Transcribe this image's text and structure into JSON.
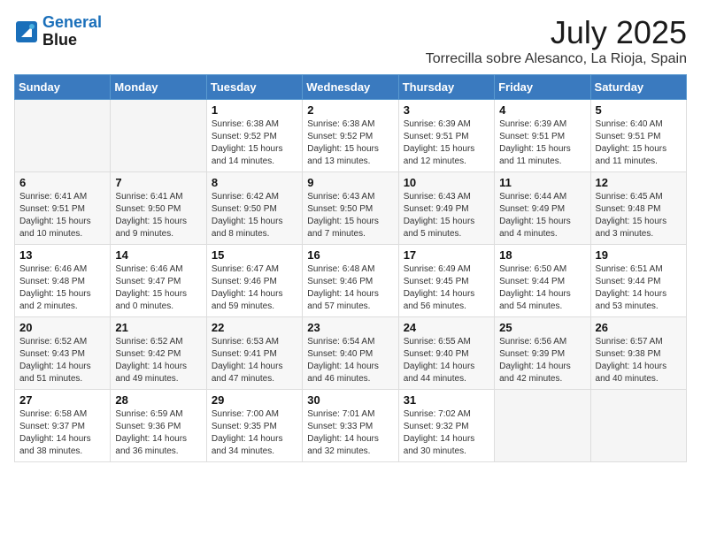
{
  "logo": {
    "line1": "General",
    "line2": "Blue"
  },
  "title": "July 2025",
  "location": "Torrecilla sobre Alesanco, La Rioja, Spain",
  "days_of_week": [
    "Sunday",
    "Monday",
    "Tuesday",
    "Wednesday",
    "Thursday",
    "Friday",
    "Saturday"
  ],
  "weeks": [
    [
      {
        "day": "",
        "info": ""
      },
      {
        "day": "",
        "info": ""
      },
      {
        "day": "1",
        "info": "Sunrise: 6:38 AM\nSunset: 9:52 PM\nDaylight: 15 hours and 14 minutes."
      },
      {
        "day": "2",
        "info": "Sunrise: 6:38 AM\nSunset: 9:52 PM\nDaylight: 15 hours and 13 minutes."
      },
      {
        "day": "3",
        "info": "Sunrise: 6:39 AM\nSunset: 9:51 PM\nDaylight: 15 hours and 12 minutes."
      },
      {
        "day": "4",
        "info": "Sunrise: 6:39 AM\nSunset: 9:51 PM\nDaylight: 15 hours and 11 minutes."
      },
      {
        "day": "5",
        "info": "Sunrise: 6:40 AM\nSunset: 9:51 PM\nDaylight: 15 hours and 11 minutes."
      }
    ],
    [
      {
        "day": "6",
        "info": "Sunrise: 6:41 AM\nSunset: 9:51 PM\nDaylight: 15 hours and 10 minutes."
      },
      {
        "day": "7",
        "info": "Sunrise: 6:41 AM\nSunset: 9:50 PM\nDaylight: 15 hours and 9 minutes."
      },
      {
        "day": "8",
        "info": "Sunrise: 6:42 AM\nSunset: 9:50 PM\nDaylight: 15 hours and 8 minutes."
      },
      {
        "day": "9",
        "info": "Sunrise: 6:43 AM\nSunset: 9:50 PM\nDaylight: 15 hours and 7 minutes."
      },
      {
        "day": "10",
        "info": "Sunrise: 6:43 AM\nSunset: 9:49 PM\nDaylight: 15 hours and 5 minutes."
      },
      {
        "day": "11",
        "info": "Sunrise: 6:44 AM\nSunset: 9:49 PM\nDaylight: 15 hours and 4 minutes."
      },
      {
        "day": "12",
        "info": "Sunrise: 6:45 AM\nSunset: 9:48 PM\nDaylight: 15 hours and 3 minutes."
      }
    ],
    [
      {
        "day": "13",
        "info": "Sunrise: 6:46 AM\nSunset: 9:48 PM\nDaylight: 15 hours and 2 minutes."
      },
      {
        "day": "14",
        "info": "Sunrise: 6:46 AM\nSunset: 9:47 PM\nDaylight: 15 hours and 0 minutes."
      },
      {
        "day": "15",
        "info": "Sunrise: 6:47 AM\nSunset: 9:46 PM\nDaylight: 14 hours and 59 minutes."
      },
      {
        "day": "16",
        "info": "Sunrise: 6:48 AM\nSunset: 9:46 PM\nDaylight: 14 hours and 57 minutes."
      },
      {
        "day": "17",
        "info": "Sunrise: 6:49 AM\nSunset: 9:45 PM\nDaylight: 14 hours and 56 minutes."
      },
      {
        "day": "18",
        "info": "Sunrise: 6:50 AM\nSunset: 9:44 PM\nDaylight: 14 hours and 54 minutes."
      },
      {
        "day": "19",
        "info": "Sunrise: 6:51 AM\nSunset: 9:44 PM\nDaylight: 14 hours and 53 minutes."
      }
    ],
    [
      {
        "day": "20",
        "info": "Sunrise: 6:52 AM\nSunset: 9:43 PM\nDaylight: 14 hours and 51 minutes."
      },
      {
        "day": "21",
        "info": "Sunrise: 6:52 AM\nSunset: 9:42 PM\nDaylight: 14 hours and 49 minutes."
      },
      {
        "day": "22",
        "info": "Sunrise: 6:53 AM\nSunset: 9:41 PM\nDaylight: 14 hours and 47 minutes."
      },
      {
        "day": "23",
        "info": "Sunrise: 6:54 AM\nSunset: 9:40 PM\nDaylight: 14 hours and 46 minutes."
      },
      {
        "day": "24",
        "info": "Sunrise: 6:55 AM\nSunset: 9:40 PM\nDaylight: 14 hours and 44 minutes."
      },
      {
        "day": "25",
        "info": "Sunrise: 6:56 AM\nSunset: 9:39 PM\nDaylight: 14 hours and 42 minutes."
      },
      {
        "day": "26",
        "info": "Sunrise: 6:57 AM\nSunset: 9:38 PM\nDaylight: 14 hours and 40 minutes."
      }
    ],
    [
      {
        "day": "27",
        "info": "Sunrise: 6:58 AM\nSunset: 9:37 PM\nDaylight: 14 hours and 38 minutes."
      },
      {
        "day": "28",
        "info": "Sunrise: 6:59 AM\nSunset: 9:36 PM\nDaylight: 14 hours and 36 minutes."
      },
      {
        "day": "29",
        "info": "Sunrise: 7:00 AM\nSunset: 9:35 PM\nDaylight: 14 hours and 34 minutes."
      },
      {
        "day": "30",
        "info": "Sunrise: 7:01 AM\nSunset: 9:33 PM\nDaylight: 14 hours and 32 minutes."
      },
      {
        "day": "31",
        "info": "Sunrise: 7:02 AM\nSunset: 9:32 PM\nDaylight: 14 hours and 30 minutes."
      },
      {
        "day": "",
        "info": ""
      },
      {
        "day": "",
        "info": ""
      }
    ]
  ]
}
